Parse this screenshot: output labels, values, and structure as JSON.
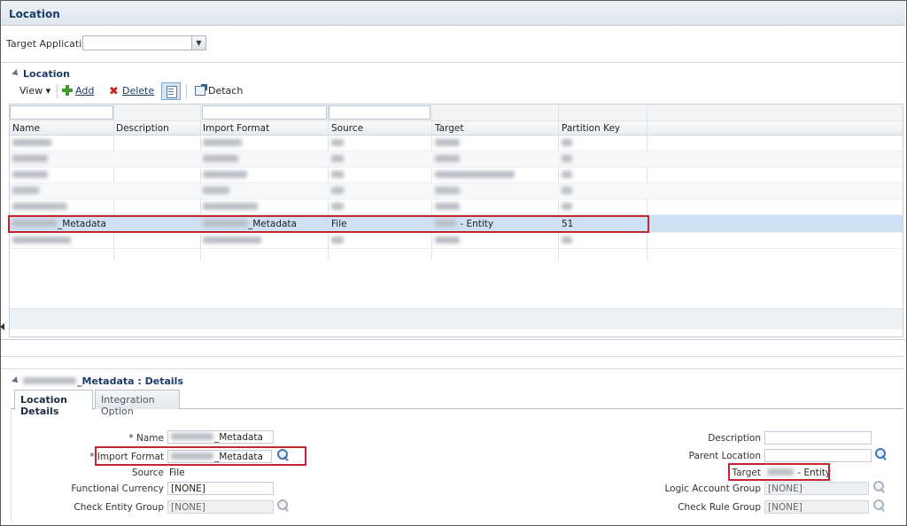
{
  "page": {
    "title": "Location"
  },
  "target_application": {
    "label": "Target Application",
    "value": ""
  },
  "location_panel": {
    "title": "Location",
    "toolbar": {
      "view_label": "View ▾",
      "add_label": "Add",
      "delete_label": "Delete",
      "detach_label": "Detach"
    },
    "columns": [
      "Name",
      "Description",
      "Import Format",
      "Source",
      "Target",
      "Partition Key"
    ],
    "selected_row": {
      "name_suffix": "_Metadata",
      "import_format_suffix": "_Metadata",
      "source": "File",
      "target_suffix": " - Entity",
      "partition_key": "51"
    }
  },
  "details": {
    "title_suffix": "_Metadata : Details",
    "tabs": [
      "Location Details",
      "Integration Option"
    ],
    "fields": {
      "name_label": "* Name",
      "name_suffix": "_Metadata",
      "import_format_label": "* Import Format",
      "import_format_suffix": "_Metadata",
      "source_label": "Source",
      "source_value": "File",
      "functional_currency_label": "Functional Currency",
      "functional_currency_value": "[NONE]",
      "check_entity_group_label": "Check Entity Group",
      "check_entity_group_value": "[NONE]",
      "description_label": "Description",
      "description_value": "",
      "parent_location_label": "Parent Location",
      "parent_location_value": "",
      "target_label": "Target",
      "target_suffix": " - Entity",
      "logic_account_group_label": "Logic Account Group",
      "logic_account_group_value": "[NONE]",
      "check_rule_group_label": "Check Rule Group",
      "check_rule_group_value": "[NONE]"
    }
  },
  "colors": {
    "accent": "#1c3c68",
    "highlight_border": "#c2262e",
    "selected_row": "#cfe0f2"
  }
}
